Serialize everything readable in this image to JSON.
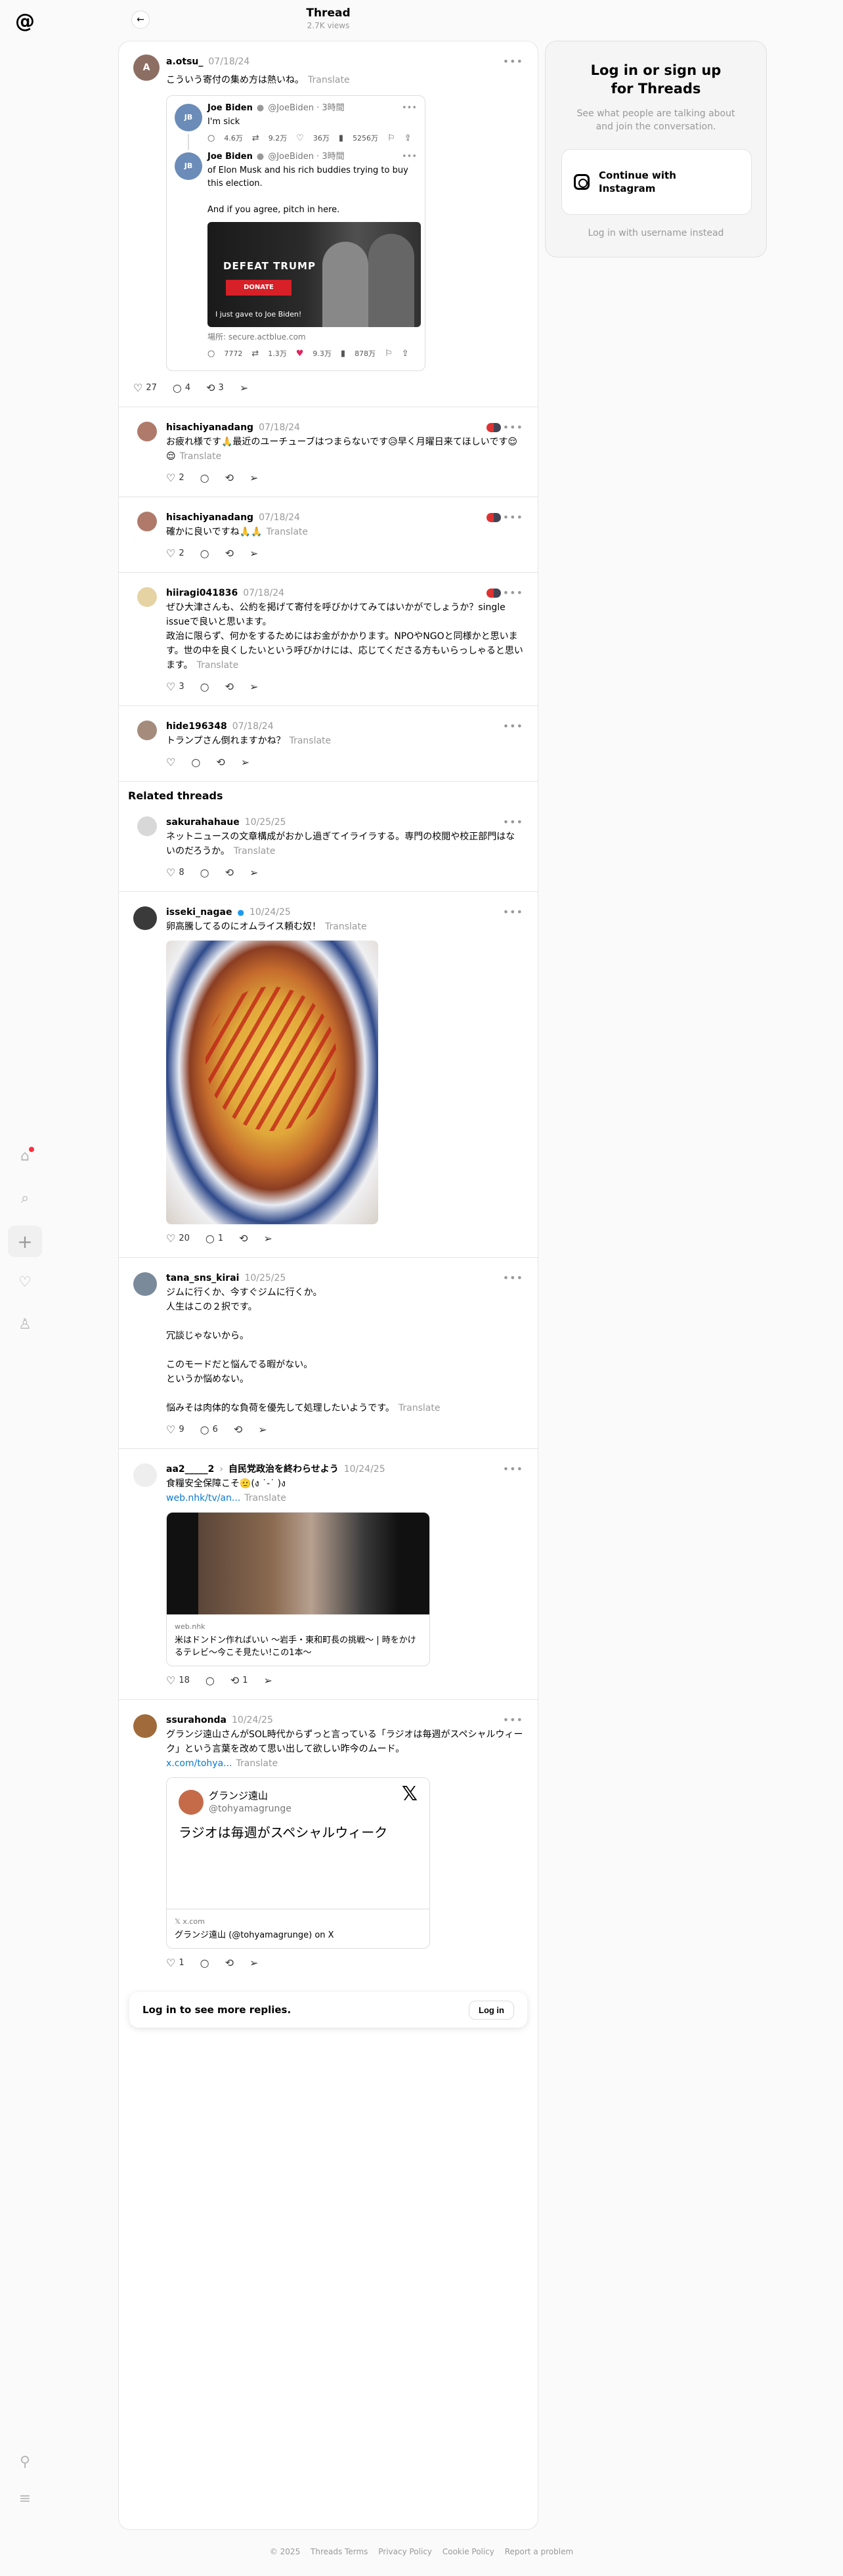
{
  "top": {
    "title": "Thread",
    "views": "2.7K views"
  },
  "right": {
    "title": "Log in or sign up\nfor Threads",
    "subtitle": "See what people are talking about\nand join the conversation.",
    "button": "Continue with\nInstagram",
    "username_login": "Log in with username instead"
  },
  "translate": "Translate",
  "main_post": {
    "user": "a.otsu_",
    "date": "07/18/24",
    "text": "こういう寄付の集め方は熱いね。",
    "quote1": {
      "user": "Joe Biden",
      "handle": "@JoeBiden · 3時間",
      "text": "I'm sick",
      "replies": "4.6万",
      "reposts": "9.2万",
      "likes": "36万",
      "views": "5256万"
    },
    "quote2": {
      "user": "Joe Biden",
      "handle": "@JoeBiden · 3時間",
      "text": "of Elon Musk and his rich buddies trying to buy this election.\n\nAnd if you agree, pitch in here.",
      "img_title": "DEFEAT TRUMP",
      "img_btn": "DONATE",
      "img_caption": "I just gave to Joe Biden!",
      "source": "場所: secure.actblue.com",
      "replies": "7772",
      "reposts": "1.3万",
      "likes": "9.3万",
      "views": "878万"
    },
    "likes": "27",
    "replies": "4",
    "reposts": "3"
  },
  "replies": [
    {
      "user": "hisachiyanadang",
      "date": "07/18/24",
      "text": "お疲れ様です🙏最近のユーチューブはつまらないです😥早く月曜日来てほしいです😌😌",
      "likes": "2",
      "replies": "",
      "reposts": ""
    },
    {
      "user": "hisachiyanadang",
      "date": "07/18/24",
      "text": "確かに良いですね🙏🙏",
      "likes": "2",
      "replies": "",
      "reposts": ""
    },
    {
      "user": "hiiragi041836",
      "date": "07/18/24",
      "text": "ぜひ大津さんも、公約を掲げて寄付を呼びかけてみてはいかがでしょうか？single issueで良いと思います。\n政治に限らず、何かをするためにはお金がかかります。NPOやNGOと同様かと思います。世の中を良くしたいという呼びかけには、応じてくださる方もいらっしゃると思います。",
      "likes": "3",
      "replies": "",
      "reposts": ""
    },
    {
      "user": "hide196348",
      "date": "07/18/24",
      "text": "トランプさん倒れますかね？",
      "likes": "",
      "replies": "",
      "reposts": ""
    }
  ],
  "related_header": "Related threads",
  "related": [
    {
      "user": "sakurahahaue",
      "date": "10/25/25",
      "text": "ネットニュースの文章構成がおかし過ぎてイライラする。専門の校閲や校正部門はないのだろうか。",
      "likes": "8",
      "replies": "",
      "reposts": ""
    },
    {
      "user": "isseki_nagae",
      "date": "10/24/25",
      "text": "卵高騰してるのにオムライス頼む奴！",
      "likes": "20",
      "replies": "1",
      "reposts": ""
    },
    {
      "user": "tana_sns_kirai",
      "date": "10/25/25",
      "text": "ジムに行くか、今すぐジムに行くか。\n人生はこの２択です。\n\n冗談じゃないから。\n\nこのモードだと悩んでる暇がない。\nというか悩めない。\n\n悩みそは肉体的な負荷を優先して処理したいようです。",
      "likes": "9",
      "replies": "6",
      "reposts": ""
    },
    {
      "user": "aa2_____2",
      "user_tag": "自民党政治を終わらせよう",
      "date": "10/24/25",
      "text": "食糧安全保障こそ🫡(ง ˙-˙ )ง",
      "link": "web.nhk/tv/an...",
      "card_domain": "web.nhk",
      "card_title": "米はドンドン作ればいい 〜岩手・東和町長の挑戦〜 | 時をかけるテレビ〜今こそ見たい!この1本〜",
      "likes": "18",
      "replies": "",
      "reposts": "1"
    },
    {
      "user": "ssurahonda",
      "date": "10/24/25",
      "text": "グランジ遠山さんがSOL時代からずっと言っている「ラジオは毎週がスペシャルウィーク」という言葉を改めて思い出して欲しい昨今のムード。",
      "link": "x.com/tohya...",
      "card_name": "グランジ遠山",
      "card_handle": "@tohyamagrunge",
      "card_text": "ラジオは毎週がスペシャルウィーク",
      "card_domain": "x.com",
      "card_title": "グランジ遠山 (@tohyamagrunge) on X",
      "likes": "1",
      "replies": "",
      "reposts": ""
    }
  ],
  "login_bar": {
    "text": "Log in to see more replies.",
    "button": "Log in"
  },
  "footer": [
    "© 2025",
    "Threads Terms",
    "Privacy Policy",
    "Cookie Policy",
    "Report a problem"
  ]
}
